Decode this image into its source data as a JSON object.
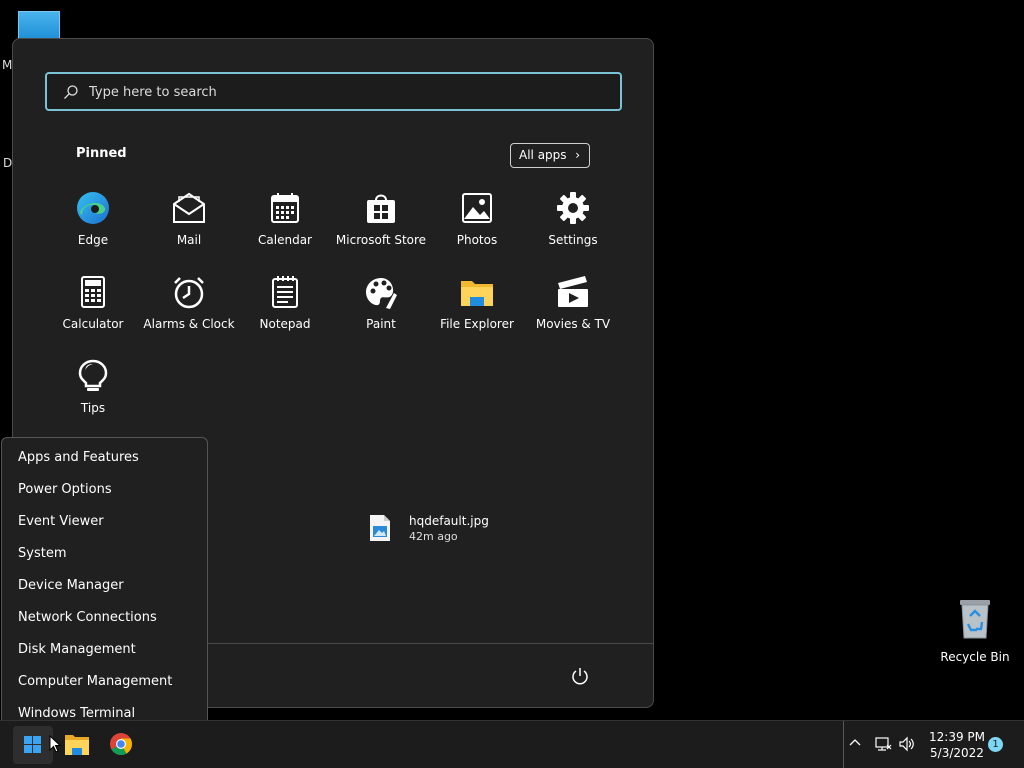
{
  "desktop": {
    "side_letters": [
      "M",
      "D"
    ],
    "recycle_bin_label": "Recycle Bin"
  },
  "start_menu": {
    "search_placeholder": "Type here to search",
    "pinned_title": "Pinned",
    "all_apps_label": "All apps",
    "apps": [
      {
        "label": "Edge",
        "icon": "edge-icon"
      },
      {
        "label": "Mail",
        "icon": "mail-icon"
      },
      {
        "label": "Calendar",
        "icon": "calendar-icon"
      },
      {
        "label": "Microsoft Store",
        "icon": "store-icon"
      },
      {
        "label": "Photos",
        "icon": "photos-icon"
      },
      {
        "label": "Settings",
        "icon": "gear-icon"
      },
      {
        "label": "Calculator",
        "icon": "calculator-icon"
      },
      {
        "label": "Alarms & Clock",
        "icon": "alarm-clock-icon"
      },
      {
        "label": "Notepad",
        "icon": "notepad-icon"
      },
      {
        "label": "Paint",
        "icon": "palette-icon"
      },
      {
        "label": "File Explorer",
        "icon": "folder-icon"
      },
      {
        "label": "Movies & TV",
        "icon": "clapperboard-icon"
      },
      {
        "label": "Tips",
        "icon": "lightbulb-icon"
      }
    ],
    "recent_file": {
      "name": "hqdefault.jpg",
      "time": "42m ago"
    }
  },
  "context_menu": {
    "items": [
      "Apps and Features",
      "Power Options",
      "Event Viewer",
      "System",
      "Device Manager",
      "Network Connections",
      "Disk Management",
      "Computer Management",
      "Windows Terminal"
    ]
  },
  "taskbar": {
    "time": "12:39 PM",
    "date": "5/3/2022",
    "notification_count": "1"
  },
  "colors": {
    "accent": "#3aa3f2",
    "search_border": "#79c3d4",
    "panel_bg": "#202020"
  }
}
